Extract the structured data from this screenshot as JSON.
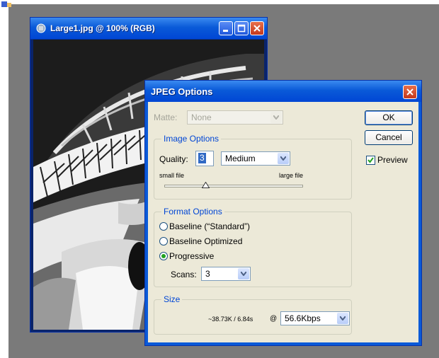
{
  "image_window": {
    "title": "Large1.jpg @ 100% (RGB)"
  },
  "dialog": {
    "title": "JPEG Options",
    "matte": {
      "label": "Matte:",
      "value": "None"
    },
    "ok_label": "OK",
    "cancel_label": "Cancel",
    "preview": {
      "label": "Preview",
      "checked": true
    },
    "image_options": {
      "legend": "Image Options",
      "quality_label": "Quality:",
      "quality_value": "3",
      "quality_preset": "Medium",
      "small_file_label": "small file",
      "large_file_label": "large file",
      "slider_level": 0.3
    },
    "format_options": {
      "legend": "Format Options",
      "options": [
        "Baseline (“Standard”)",
        "Baseline Optimized",
        "Progressive"
      ],
      "selected": "Progressive",
      "scans_label": "Scans:",
      "scans_value": "3"
    },
    "size": {
      "legend": "Size",
      "estimate": "~38.73K / 6.84s",
      "at": "@",
      "speed": "56.6Kbps"
    }
  }
}
